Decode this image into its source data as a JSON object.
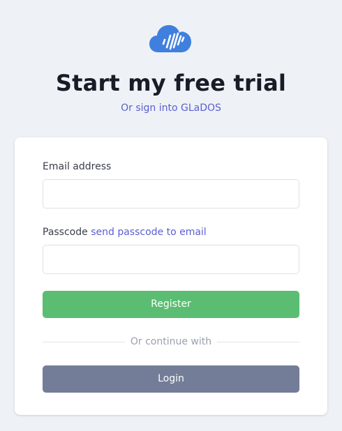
{
  "header": {
    "logo_icon": "cloud-soundwave-logo",
    "title": "Start my free trial",
    "subtitle_prefix": "Or",
    "signin_link": "sign into GLaDOS"
  },
  "form": {
    "email_label": "Email address",
    "email_value": "",
    "passcode_label": "Passcode",
    "send_passcode_link": "send passcode to email",
    "passcode_value": "",
    "register_label": "Register",
    "divider_text": "Or continue with",
    "login_label": "Login"
  },
  "colors": {
    "background": "#eef1f6",
    "brand_blue": "#3f7fde",
    "link": "#5a5fd0",
    "register_green": "#5bbd72",
    "login_slate": "#737d97"
  }
}
